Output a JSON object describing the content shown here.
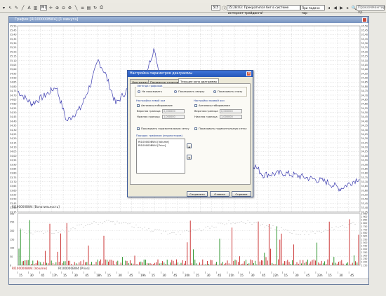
{
  "toolbar": {
    "period_value": "M1",
    "counter_text": "3/3",
    "status_text": "15:28:03: Прекратился бег в системе интернет-трейдинга!",
    "help_prompt": "При подаче пор",
    "search_placeholder": "Прокомментир пр"
  },
  "window": {
    "title": "График [RI100000BW4] [1 минута]"
  },
  "price_panel": {
    "y_ticks": [
      "35,50",
      "35,45",
      "35,40",
      "35,35",
      "35,30",
      "35,25",
      "35,20",
      "35,15",
      "35,10",
      "35,05",
      "35,00",
      "34,95",
      "34,90",
      "34,85",
      "34,80",
      "34,75",
      "34,70",
      "34,65",
      "34,60",
      "34,55",
      "34,50",
      "34,45",
      "34,40",
      "34,35",
      "34,30",
      "34,25",
      "34,20",
      "34,15",
      "34,10",
      "34,05",
      "34,00",
      "33,95",
      "33,90",
      "33,85",
      "33,80",
      "33,75",
      "33,70",
      "33,65",
      "33,60",
      "33,55",
      "33,50",
      "33,45",
      "33,40",
      "33,35"
    ],
    "legend": "RI100000BW4 [Волатильность]",
    "line_color": "#3b3bb0"
  },
  "volume_panel": {
    "y_ticks_left": [
      "300",
      "250",
      "200",
      "150",
      "100",
      "50",
      "0"
    ],
    "y_ticks_right": [
      "1 950",
      "1 900",
      "1 850",
      "1 800",
      "1 750",
      "1 700",
      "1 650",
      "1 600",
      "1 550",
      "1 500",
      "1 450",
      "1 400",
      "1 350",
      "1 300",
      "1 250",
      "1 200",
      "1 150"
    ],
    "legend_volume": "RI100000BW4 [Volume]",
    "legend_price": "RI100000BW4 [Price]"
  },
  "time_axis": {
    "labels": [
      "15",
      "30",
      "45",
      "17h",
      "15",
      "30",
      "45",
      "18h",
      "15",
      "30",
      "45",
      "19h",
      "15",
      "30",
      "45",
      "20h",
      "15",
      "30",
      "45",
      "21h",
      "15",
      "30",
      "45",
      "22h",
      "15",
      "30",
      "45",
      "23h",
      "15",
      "30",
      "45"
    ]
  },
  "dialog": {
    "title": "Настройка параметров диаграммы",
    "tabs": [
      "Диаграмма",
      "Параметры отрисовки",
      "Текущее окно диаграммы"
    ],
    "active_tab": 2,
    "legend_group": "Легенда графиков",
    "legend_options": [
      "Не показывать",
      "Показывать сверху",
      "Показывать снизу"
    ],
    "left_axis_group": "Настройки левой оси",
    "right_axis_group": "Настройки правой оси",
    "auto_scale_label": "Автомасштабирование",
    "upper_bound_label": "Верхняя граница",
    "lower_bound_label": "Нижняя граница",
    "left_upper_value": "0,000000",
    "left_lower_value": "1,000000",
    "right_upper_value": "0,000000",
    "right_lower_value": "1,000000",
    "grid_label": "Показывать горизонтальную сетку",
    "order_group": "Порядок графиков (индикаторов)",
    "series": [
      "RI100000BW4 [Volume]",
      "RI100000BW4 [Price]"
    ],
    "ok_label": "Сохранить",
    "cancel_label": "Отмена",
    "help_label": "Справка"
  }
}
